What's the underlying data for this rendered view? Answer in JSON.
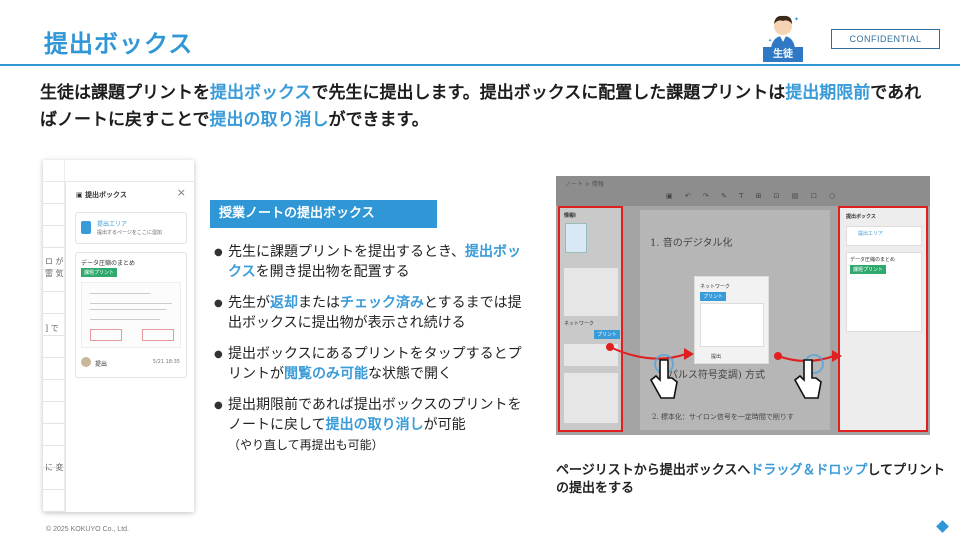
{
  "header": {
    "title": "提出ボックス",
    "confidential": "CONFIDENTIAL",
    "role_badge": "生徒"
  },
  "lead": {
    "p1": "生徒は課題プリントを",
    "h1": "提出ボックス",
    "p2": "で先生に提出します。提出ボックスに配置した課題プリントは",
    "h2": "提出期限前",
    "p3": "であればノートに戻すことで",
    "h3": "提出の取り消し",
    "p4": "ができます。"
  },
  "left_mock": {
    "panel_title": "提出ボックス",
    "close_glyph": "×",
    "area_title": "提出エリア",
    "area_hint": "提出するページをここに湿加",
    "card_title": "データ圧縮のまとめ",
    "card_tag": "課題プリント",
    "submitter": "提出",
    "date": "5/21 18:35",
    "hand_left": [
      "ロ が",
      "雷 気",
      "] で",
      "に 変"
    ]
  },
  "section": {
    "heading": "授業ノートの提出ボックス",
    "b1_pre": "先生に課題プリントを提出するとき、",
    "b1_hl": "提出ボックス",
    "b1_post": "を開き提出物を配置する",
    "b2_pre": "先生が",
    "b2_hl1": "返却",
    "b2_mid": "または",
    "b2_hl2": "チェック済み",
    "b2_post": "とするまでは提出ボックスに提出物が表示され続ける",
    "b3_pre": "提出ボックスにあるプリントをタップするとプリントが",
    "b3_hl": "閲覧のみ可能",
    "b3_post": "な状態で開く",
    "b4_pre": "提出期限前であれば提出ボックスのプリントをノートに戻して",
    "b4_hl": "提出の取り消し",
    "b4_post": "が可能",
    "b4_note": "（やり直して再提出も可能）"
  },
  "screenshot": {
    "nav_text": "ノート > 情報",
    "left_title": "情報I",
    "left_net": "ネットワーク",
    "left_tag": "プリント",
    "popup_title": "ネットワーク",
    "popup_tag": "プリント",
    "popup_user": "提出",
    "right_title": "提出ボックス",
    "right_area": "提出エリア",
    "right_card": "データ圧縮のまとめ",
    "right_tag": "課題プリント",
    "hw1": "1. 音のデジタル化",
    "hw2": "(パルス符号変調) 方式",
    "hw3": "2. 標本化：サイロン信号を一定時間で削りす"
  },
  "caption_pre": "ページリストから提出ボックスへ",
  "caption_hl": "ドラッグ＆ドロップ",
  "caption_post": "してプリントの提出をする",
  "footer": "© 2025 KOKUYO Co., Ltd."
}
